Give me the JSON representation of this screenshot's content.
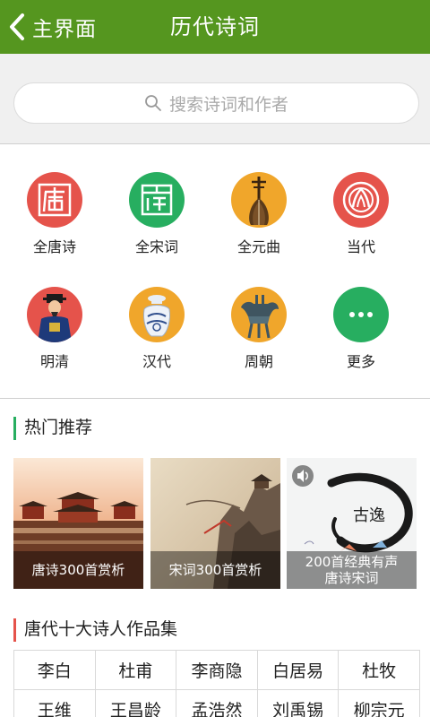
{
  "header": {
    "back_label": "主界面",
    "title": "历代诗词",
    "bg": "#55961f"
  },
  "search": {
    "placeholder": "搜索诗词和作者"
  },
  "categories": [
    {
      "label": "全唐诗",
      "icon": "tang-seal-icon",
      "color": "#e5534b"
    },
    {
      "label": "全宋词",
      "icon": "song-seal-icon",
      "color": "#27ae60"
    },
    {
      "label": "全元曲",
      "icon": "pipa-instrument-icon",
      "color": "#f0a62b"
    },
    {
      "label": "当代",
      "icon": "modern-emblem-icon",
      "color": "#e5534b"
    },
    {
      "label": "明清",
      "icon": "ming-official-icon",
      "color": "#e5534b"
    },
    {
      "label": "汉代",
      "icon": "porcelain-jar-icon",
      "color": "#f0a62b"
    },
    {
      "label": "周朝",
      "icon": "bronze-vessel-icon",
      "color": "#f0a62b"
    },
    {
      "label": "更多",
      "icon": "more-dots-icon",
      "color": "#27ae60"
    }
  ],
  "hot": {
    "title": "热门推荐",
    "accent": "#27ae60",
    "cards": [
      {
        "caption": "唐诗300首赏析"
      },
      {
        "caption": "宋词300首赏析"
      },
      {
        "caption_line1": "200首经典有声",
        "caption_line2": "唐诗宋词",
        "badge": "speaker-icon"
      }
    ]
  },
  "poets": {
    "title": "唐代十大诗人作品集",
    "accent": "#e5534b",
    "row1": [
      "李白",
      "杜甫",
      "李商隐",
      "白居易",
      "杜牧"
    ],
    "row2": [
      "王维",
      "王昌龄",
      "孟浩然",
      "刘禹锡",
      "柳宗元"
    ]
  }
}
